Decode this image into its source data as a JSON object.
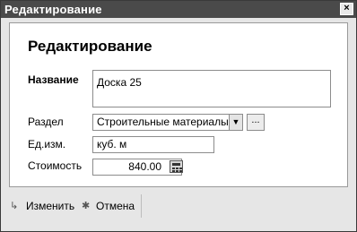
{
  "window": {
    "title": "Редактирование",
    "close_label": "×"
  },
  "form": {
    "heading": "Редактирование",
    "name": {
      "label": "Название",
      "value": "Доска 25"
    },
    "section": {
      "label": "Раздел",
      "value": "Строительные материалы",
      "browse_label": "..."
    },
    "unit": {
      "label": "Ед.изм.",
      "value": "куб. м"
    },
    "cost": {
      "label": "Стоимость",
      "value": "840.00"
    }
  },
  "toolbar": {
    "change_label": "Изменить",
    "cancel_label": "Отмена"
  }
}
